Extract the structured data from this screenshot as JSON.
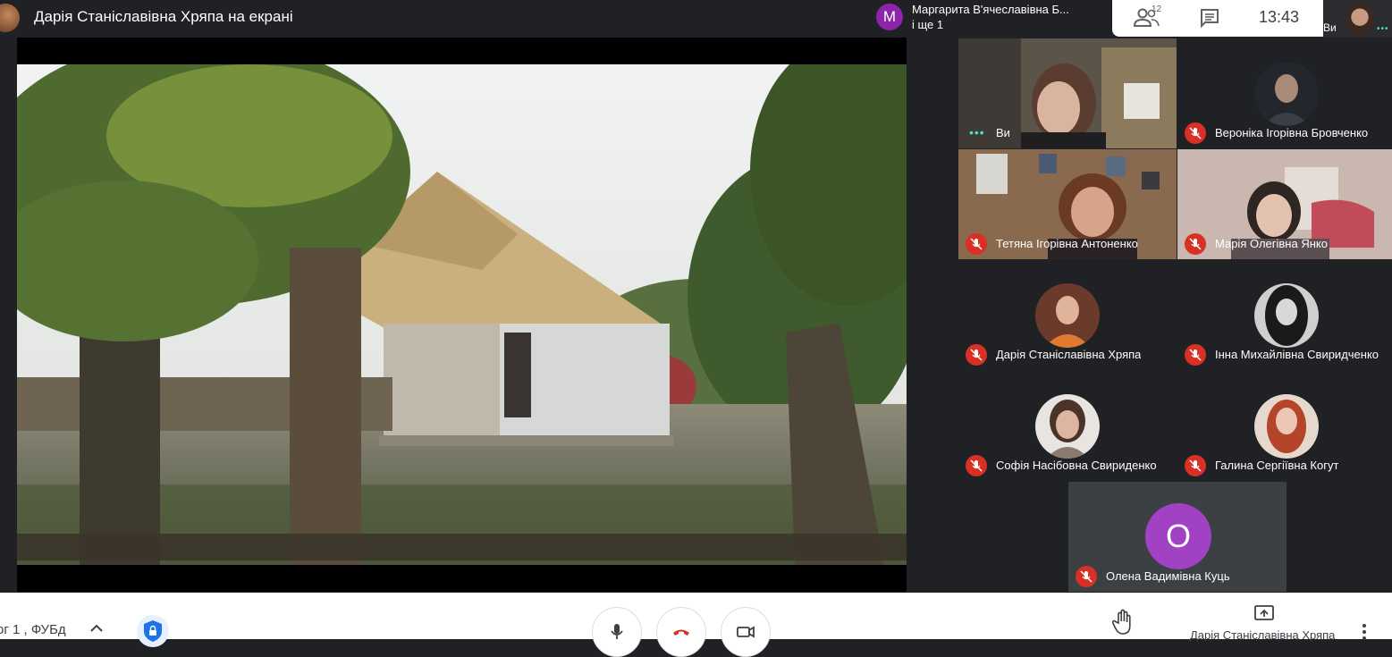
{
  "topbar": {
    "presenter_title": "Дарія Станіславівна Хряпа на екрані",
    "notification": {
      "avatar_letter": "M",
      "line1": "Маргарита В'ячеславівна Б...",
      "line2": "і ще 1"
    },
    "participants_badge": "12",
    "time": "13:43",
    "self_label": "Ви"
  },
  "tiles": {
    "you": "Ви",
    "veronika": "Вероніка Ігорівна Бровченко",
    "tetiana": "Тетяна Ігорівна Антоненко",
    "mariia": "Марія Олегівна Янко",
    "dariia": "Дарія Станіславівна Хряпа",
    "inna": "Інна Михайлівна Свиридченко",
    "sofiia": "Софія Насібовна Свириденко",
    "halyna": "Галина Сергіївна Когут",
    "olena": "Олена Вадимівна Куць",
    "olena_letter": "О"
  },
  "bottombar": {
    "meeting_name": "ог 1 , ФУБд",
    "presenter_label": "Дарія Станіславівна Хряпа"
  },
  "colors": {
    "background": "#202124",
    "tile": "#3c4043",
    "muted_red": "#d93025",
    "letter_avatar": "#a142c4",
    "speaking_teal": "#4de0c8"
  }
}
